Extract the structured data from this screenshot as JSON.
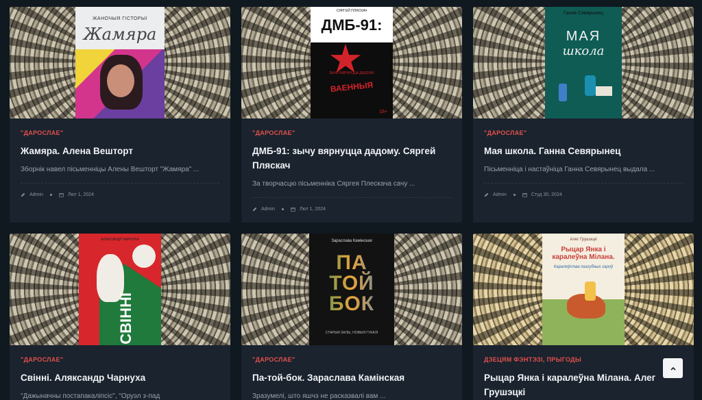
{
  "posts": [
    {
      "category": "\"ДАРОСЛАЕ\"",
      "title": "Жамяра. Алена Вешторт",
      "excerpt": "Зборнік навел пісьменніцы Алены Вешторт \"Жамяра\" ...",
      "author": "Admin",
      "date": "Лют 1, 2024",
      "cover": {
        "top": "ЖАНОЧЫЯ ГІСТОРЫІ",
        "main": "Жамяра",
        "bg": "#ecedee",
        "accent": "#d3358c"
      }
    },
    {
      "category": "\"ДАРОСЛАЕ\"",
      "title": "ДМБ-91: зычу вярнуцца дадому. Сяргей Пляскач",
      "excerpt": "За творчасцю пісьменніка Сяргея Плескача сачу ...",
      "author": "Admin",
      "date": "Лют 1, 2024",
      "cover": {
        "top": "СЯРГЕЙ ПЛЯСКАЧ",
        "main": "ДМБ-91:",
        "sub": "ЗЫЧУ ВЯРНУЦЦА ДАДОМУ",
        "label": "ВАЕННЫЯ",
        "age": "18+",
        "bg": "#0d0d0d",
        "accent": "#d3232a"
      }
    },
    {
      "category": "\"ДАРОСЛАЕ\"",
      "title": "Мая школа. Ганна Севярынец",
      "excerpt": "Пісьменніца і настаўніца Ганна Севярынец выдала ...",
      "author": "Admin",
      "date": "Студ 30, 2024",
      "cover": {
        "top": "Ганна Севярынец",
        "main": "МАЯ",
        "sub": "школа",
        "bg": "#0f5c55",
        "accent": "#f2f2f2"
      }
    },
    {
      "category": "\"ДАРОСЛАЕ\"",
      "title": "Свінні. Аляксандр Чарнуха",
      "excerpt": "\"Дажыначны постапакаліпсіс\", \"Оруэл з-пад",
      "cover": {
        "top": "АЛЯКСАНДР ЧАРНУХА",
        "main": "СВІННІ",
        "bg": "#d7272c",
        "accent": "#1f7a3b"
      }
    },
    {
      "category": "\"ДАРОСЛАЕ\"",
      "title": "Па-той-бок. Зараслава Камінская",
      "excerpt": "Зразумелі, што яшчэ не расказвалі вам ...",
      "cover": {
        "top": "Зараслава Камінская",
        "main": "ПА ТОЙ БОК",
        "sub": "СТАРЫЯ ЗАЛЫ, НОВЫЯ ГУКАЛІ",
        "bg": "#121212",
        "accent": "#e8a33a"
      }
    },
    {
      "category": "ДЗЕЦЯМ  ФЭНТЭЗІ, ПРЫГОДЫ",
      "title": "Рыцар Янка і каралеўна Мілана. Алег Грушэцкі",
      "cover": {
        "top": "Алег Грушэцкі",
        "main": "Рыцар Янка і каралеўна Мілана.",
        "sub": "Каралеўства пазгубных гароў",
        "bg": "#f4eee0",
        "accent": "#c9403a"
      }
    }
  ],
  "ui": {
    "back_to_top": "back-to-top",
    "author_icon": "pen-icon",
    "date_icon": "calendar-icon"
  },
  "colors": {
    "category": "#e2504c",
    "page_bg": "#101820",
    "card_bg": "#1a232e"
  }
}
